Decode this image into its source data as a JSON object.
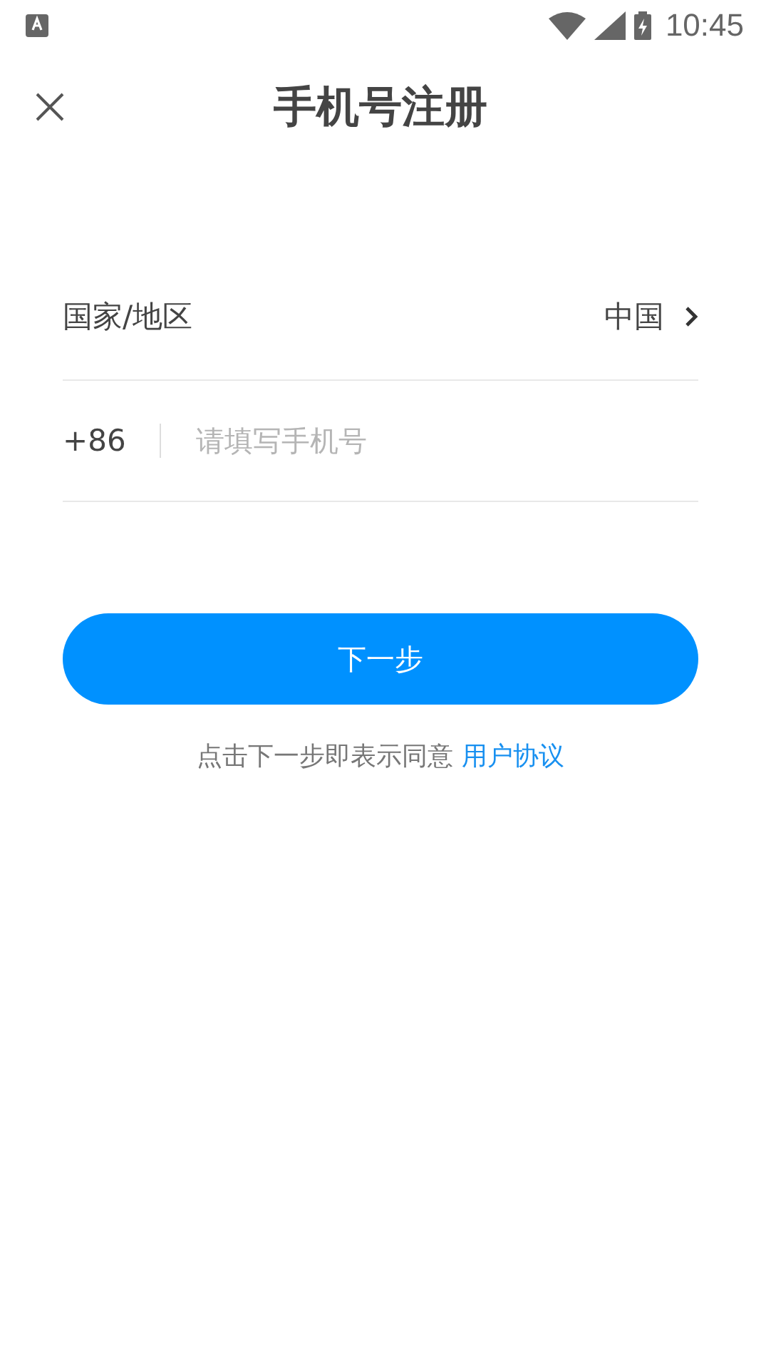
{
  "status_bar": {
    "time": "10:45"
  },
  "header": {
    "title": "手机号注册"
  },
  "country_row": {
    "label": "国家/地区",
    "value": "中国"
  },
  "phone_row": {
    "prefix": "+86",
    "placeholder": "请填写手机号"
  },
  "next_button": {
    "label": "下一步"
  },
  "agreement": {
    "text": "点击下一步即表示同意",
    "link": "用户协议"
  }
}
